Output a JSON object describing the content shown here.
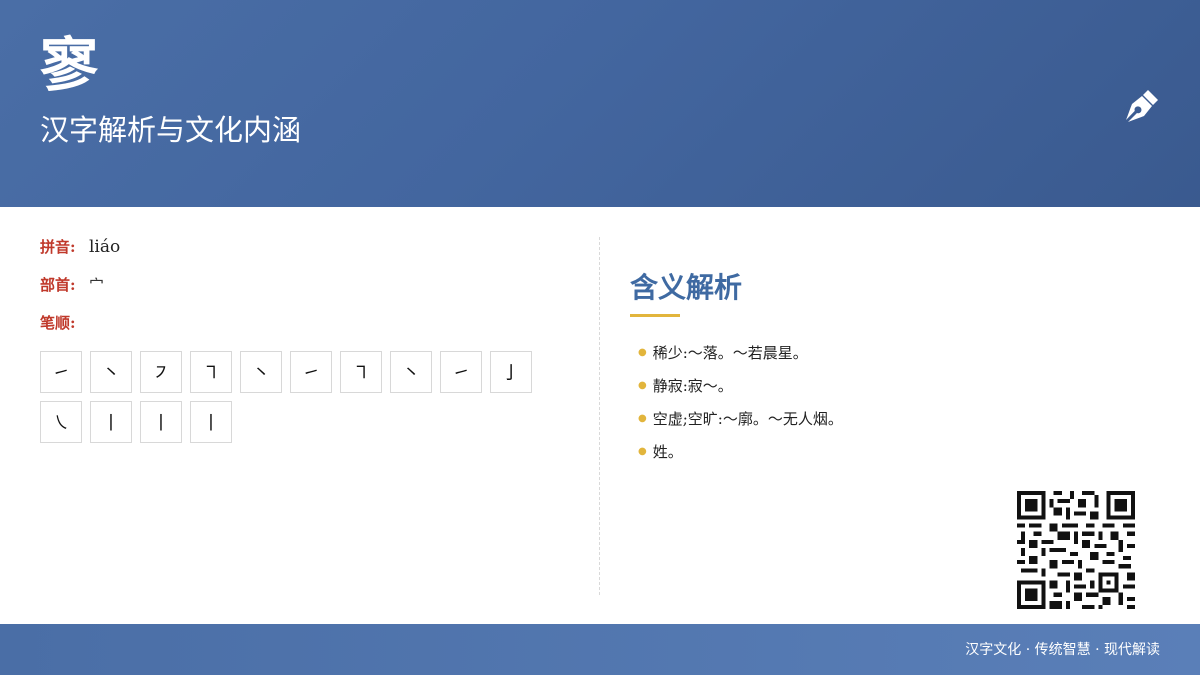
{
  "header": {
    "character": "寥",
    "subtitle": "汉字解析与文化内涵",
    "icon": "pen-nib-icon"
  },
  "info": {
    "pinyin_label": "拼音:",
    "pinyin_value": "liáo",
    "radical_label": "部首:",
    "radical_value": "宀",
    "strokes_label": "笔顺:"
  },
  "strokes": {
    "row1": [
      "㇀",
      "㇔",
      "㇇",
      "㇕",
      "㇔",
      "㇀",
      "㇕",
      "㇔",
      "㇀",
      "亅"
    ],
    "row2": [
      "㇏",
      "丨",
      "丨",
      "丨"
    ]
  },
  "meaning": {
    "title": "含义解析",
    "items": [
      "稀少:～落。～若晨星。",
      "静寂:寂～。",
      "空虚;空旷:～廓。～无人烟。",
      "姓。"
    ]
  },
  "footer": {
    "text": "汉字文化 · 传统智慧 · 现代解读"
  },
  "colors": {
    "header_bg": "#43669f",
    "label_red": "#c0392b",
    "title_blue": "#3f6aa2",
    "accent_gold": "#e2b53c"
  }
}
